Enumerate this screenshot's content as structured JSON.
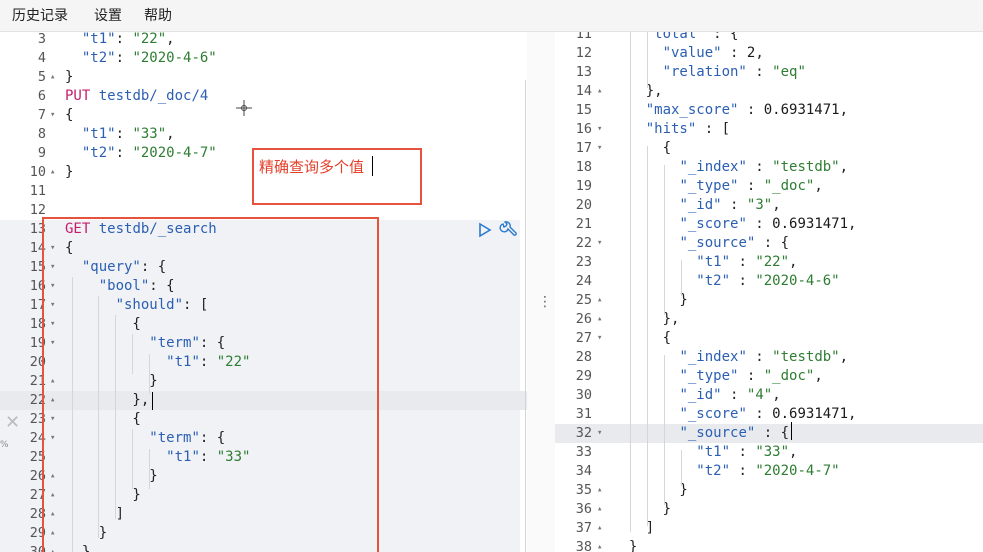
{
  "menu": [
    "历史记录",
    "设置",
    "帮助"
  ],
  "colors": {
    "method": "#c41d6b",
    "key": "#2b5fb3",
    "string": "#2e7d32",
    "number": "#1a1a1a",
    "punct": "#222222",
    "annotation": "#e5533d"
  },
  "annotation": "精确查询多个值",
  "left_lines": [
    {
      "n": "3",
      "fold": "",
      "tokens": [
        [
          "p",
          "  "
        ],
        [
          "k",
          "\"t1\""
        ],
        [
          "p",
          ": "
        ],
        [
          "s",
          "\"22\""
        ],
        [
          "p",
          ","
        ]
      ]
    },
    {
      "n": "4",
      "fold": "",
      "tokens": [
        [
          "p",
          "  "
        ],
        [
          "k",
          "\"t2\""
        ],
        [
          "p",
          ": "
        ],
        [
          "s",
          "\"2020-4-6\""
        ]
      ]
    },
    {
      "n": "5",
      "fold": "▴",
      "tokens": [
        [
          "p",
          "}"
        ]
      ]
    },
    {
      "n": "6",
      "fold": "",
      "tokens": [
        [
          "m",
          "PUT"
        ],
        [
          "p",
          " "
        ],
        [
          "k",
          "testdb/_doc/4"
        ]
      ]
    },
    {
      "n": "7",
      "fold": "▾",
      "tokens": [
        [
          "p",
          "{"
        ]
      ]
    },
    {
      "n": "8",
      "fold": "",
      "tokens": [
        [
          "p",
          "  "
        ],
        [
          "k",
          "\"t1\""
        ],
        [
          "p",
          ": "
        ],
        [
          "s",
          "\"33\""
        ],
        [
          "p",
          ","
        ]
      ]
    },
    {
      "n": "9",
      "fold": "",
      "tokens": [
        [
          "p",
          "  "
        ],
        [
          "k",
          "\"t2\""
        ],
        [
          "p",
          ": "
        ],
        [
          "s",
          "\"2020-4-7\""
        ]
      ]
    },
    {
      "n": "10",
      "fold": "▴",
      "tokens": [
        [
          "p",
          "}"
        ]
      ]
    },
    {
      "n": "11",
      "fold": "",
      "tokens": []
    },
    {
      "n": "12",
      "fold": "",
      "tokens": []
    },
    {
      "n": "13",
      "fold": "",
      "tokens": [
        [
          "m",
          "GET"
        ],
        [
          "p",
          " "
        ],
        [
          "k",
          "testdb/_search"
        ]
      ]
    },
    {
      "n": "14",
      "fold": "▾",
      "tokens": [
        [
          "p",
          "{"
        ]
      ]
    },
    {
      "n": "15",
      "fold": "▾",
      "tokens": [
        [
          "p",
          "  "
        ],
        [
          "k",
          "\"query\""
        ],
        [
          "p",
          ": {"
        ]
      ]
    },
    {
      "n": "16",
      "fold": "▾",
      "tokens": [
        [
          "p",
          "    "
        ],
        [
          "k",
          "\"bool\""
        ],
        [
          "p",
          ": {"
        ]
      ]
    },
    {
      "n": "17",
      "fold": "▾",
      "tokens": [
        [
          "p",
          "      "
        ],
        [
          "k",
          "\"should\""
        ],
        [
          "p",
          ": ["
        ]
      ]
    },
    {
      "n": "18",
      "fold": "▾",
      "tokens": [
        [
          "p",
          "        {"
        ]
      ]
    },
    {
      "n": "19",
      "fold": "▾",
      "tokens": [
        [
          "p",
          "          "
        ],
        [
          "k",
          "\"term\""
        ],
        [
          "p",
          ": {"
        ]
      ]
    },
    {
      "n": "20",
      "fold": "",
      "tokens": [
        [
          "p",
          "            "
        ],
        [
          "k",
          "\"t1\""
        ],
        [
          "p",
          ": "
        ],
        [
          "s",
          "\"22\""
        ]
      ]
    },
    {
      "n": "21",
      "fold": "▴",
      "tokens": [
        [
          "p",
          "          }"
        ]
      ]
    },
    {
      "n": "22",
      "fold": "▴",
      "tokens": [
        [
          "p",
          "        },"
        ]
      ]
    },
    {
      "n": "23",
      "fold": "▾",
      "tokens": [
        [
          "p",
          "        {"
        ]
      ]
    },
    {
      "n": "24",
      "fold": "▾",
      "tokens": [
        [
          "p",
          "          "
        ],
        [
          "k",
          "\"term\""
        ],
        [
          "p",
          ": {"
        ]
      ]
    },
    {
      "n": "25",
      "fold": "",
      "tokens": [
        [
          "p",
          "            "
        ],
        [
          "k",
          "\"t1\""
        ],
        [
          "p",
          ": "
        ],
        [
          "s",
          "\"33\""
        ]
      ]
    },
    {
      "n": "26",
      "fold": "▴",
      "tokens": [
        [
          "p",
          "          }"
        ]
      ]
    },
    {
      "n": "27",
      "fold": "▴",
      "tokens": [
        [
          "p",
          "        }"
        ]
      ]
    },
    {
      "n": "28",
      "fold": "▴",
      "tokens": [
        [
          "p",
          "      ]"
        ]
      ]
    },
    {
      "n": "29",
      "fold": "▴",
      "tokens": [
        [
          "p",
          "    }"
        ]
      ]
    },
    {
      "n": "30",
      "fold": "▴",
      "tokens": [
        [
          "p",
          "  }"
        ]
      ]
    }
  ],
  "right_lines": [
    {
      "n": "11",
      "fold": "",
      "tokens": [
        [
          "p",
          "    "
        ],
        [
          "k",
          "\"total\""
        ],
        [
          "p",
          " : {"
        ]
      ]
    },
    {
      "n": "12",
      "fold": "",
      "tokens": [
        [
          "p",
          "      "
        ],
        [
          "k",
          "\"value\""
        ],
        [
          "p",
          " : "
        ],
        [
          "d",
          "2"
        ],
        [
          "p",
          ","
        ]
      ]
    },
    {
      "n": "13",
      "fold": "",
      "tokens": [
        [
          "p",
          "      "
        ],
        [
          "k",
          "\"relation\""
        ],
        [
          "p",
          " : "
        ],
        [
          "s",
          "\"eq\""
        ]
      ]
    },
    {
      "n": "14",
      "fold": "▴",
      "tokens": [
        [
          "p",
          "    },"
        ]
      ]
    },
    {
      "n": "15",
      "fold": "",
      "tokens": [
        [
          "p",
          "    "
        ],
        [
          "k",
          "\"max_score\""
        ],
        [
          "p",
          " : "
        ],
        [
          "d",
          "0.6931471"
        ],
        [
          "p",
          ","
        ]
      ]
    },
    {
      "n": "16",
      "fold": "▾",
      "tokens": [
        [
          "p",
          "    "
        ],
        [
          "k",
          "\"hits\""
        ],
        [
          "p",
          " : ["
        ]
      ]
    },
    {
      "n": "17",
      "fold": "▾",
      "tokens": [
        [
          "p",
          "      {"
        ]
      ]
    },
    {
      "n": "18",
      "fold": "",
      "tokens": [
        [
          "p",
          "        "
        ],
        [
          "k",
          "\"_index\""
        ],
        [
          "p",
          " : "
        ],
        [
          "s",
          "\"testdb\""
        ],
        [
          "p",
          ","
        ]
      ]
    },
    {
      "n": "19",
      "fold": "",
      "tokens": [
        [
          "p",
          "        "
        ],
        [
          "k",
          "\"_type\""
        ],
        [
          "p",
          " : "
        ],
        [
          "s",
          "\"_doc\""
        ],
        [
          "p",
          ","
        ]
      ]
    },
    {
      "n": "20",
      "fold": "",
      "tokens": [
        [
          "p",
          "        "
        ],
        [
          "k",
          "\"_id\""
        ],
        [
          "p",
          " : "
        ],
        [
          "s",
          "\"3\""
        ],
        [
          "p",
          ","
        ]
      ]
    },
    {
      "n": "21",
      "fold": "",
      "tokens": [
        [
          "p",
          "        "
        ],
        [
          "k",
          "\"_score\""
        ],
        [
          "p",
          " : "
        ],
        [
          "d",
          "0.6931471"
        ],
        [
          "p",
          ","
        ]
      ]
    },
    {
      "n": "22",
      "fold": "▾",
      "tokens": [
        [
          "p",
          "        "
        ],
        [
          "k",
          "\"_source\""
        ],
        [
          "p",
          " : {"
        ]
      ]
    },
    {
      "n": "23",
      "fold": "",
      "tokens": [
        [
          "p",
          "          "
        ],
        [
          "k",
          "\"t1\""
        ],
        [
          "p",
          " : "
        ],
        [
          "s",
          "\"22\""
        ],
        [
          "p",
          ","
        ]
      ]
    },
    {
      "n": "24",
      "fold": "",
      "tokens": [
        [
          "p",
          "          "
        ],
        [
          "k",
          "\"t2\""
        ],
        [
          "p",
          " : "
        ],
        [
          "s",
          "\"2020-4-6\""
        ]
      ]
    },
    {
      "n": "25",
      "fold": "▴",
      "tokens": [
        [
          "p",
          "        }"
        ]
      ]
    },
    {
      "n": "26",
      "fold": "▴",
      "tokens": [
        [
          "p",
          "      },"
        ]
      ]
    },
    {
      "n": "27",
      "fold": "▾",
      "tokens": [
        [
          "p",
          "      {"
        ]
      ]
    },
    {
      "n": "28",
      "fold": "",
      "tokens": [
        [
          "p",
          "        "
        ],
        [
          "k",
          "\"_index\""
        ],
        [
          "p",
          " : "
        ],
        [
          "s",
          "\"testdb\""
        ],
        [
          "p",
          ","
        ]
      ]
    },
    {
      "n": "29",
      "fold": "",
      "tokens": [
        [
          "p",
          "        "
        ],
        [
          "k",
          "\"_type\""
        ],
        [
          "p",
          " : "
        ],
        [
          "s",
          "\"_doc\""
        ],
        [
          "p",
          ","
        ]
      ]
    },
    {
      "n": "30",
      "fold": "",
      "tokens": [
        [
          "p",
          "        "
        ],
        [
          "k",
          "\"_id\""
        ],
        [
          "p",
          " : "
        ],
        [
          "s",
          "\"4\""
        ],
        [
          "p",
          ","
        ]
      ]
    },
    {
      "n": "31",
      "fold": "",
      "tokens": [
        [
          "p",
          "        "
        ],
        [
          "k",
          "\"_score\""
        ],
        [
          "p",
          " : "
        ],
        [
          "d",
          "0.6931471"
        ],
        [
          "p",
          ","
        ]
      ]
    },
    {
      "n": "32",
      "fold": "▾",
      "tokens": [
        [
          "p",
          "        "
        ],
        [
          "k",
          "\"_source\""
        ],
        [
          "p",
          " : {"
        ]
      ]
    },
    {
      "n": "33",
      "fold": "",
      "tokens": [
        [
          "p",
          "          "
        ],
        [
          "k",
          "\"t1\""
        ],
        [
          "p",
          " : "
        ],
        [
          "s",
          "\"33\""
        ],
        [
          "p",
          ","
        ]
      ]
    },
    {
      "n": "34",
      "fold": "",
      "tokens": [
        [
          "p",
          "          "
        ],
        [
          "k",
          "\"t2\""
        ],
        [
          "p",
          " : "
        ],
        [
          "s",
          "\"2020-4-7\""
        ]
      ]
    },
    {
      "n": "35",
      "fold": "▴",
      "tokens": [
        [
          "p",
          "        }"
        ]
      ]
    },
    {
      "n": "36",
      "fold": "▴",
      "tokens": [
        [
          "p",
          "      }"
        ]
      ]
    },
    {
      "n": "37",
      "fold": "▴",
      "tokens": [
        [
          "p",
          "    ]"
        ]
      ]
    },
    {
      "n": "38",
      "fold": "▴",
      "tokens": [
        [
          "p",
          "  }"
        ]
      ]
    }
  ],
  "icons": {
    "run": "play-icon",
    "settings": "wrench-icon",
    "close": "close-icon",
    "splitter": "drag-handle-icon"
  }
}
